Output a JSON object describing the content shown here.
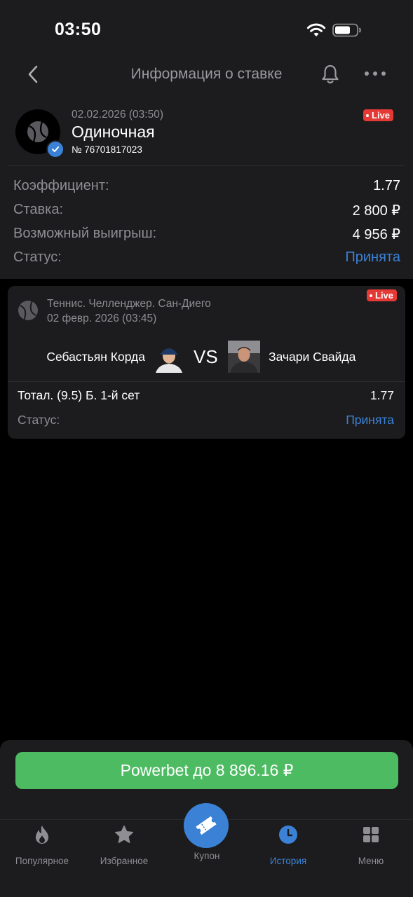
{
  "status_bar": {
    "time": "03:50"
  },
  "nav": {
    "title": "Информация о ставке"
  },
  "bet": {
    "date": "02.02.2026 (03:50)",
    "type": "Одиночная",
    "number": "№ 76701817023",
    "live_label": "Live"
  },
  "details": [
    {
      "key": "Коэффициент:",
      "value": "1.77"
    },
    {
      "key": "Ставка:",
      "value": "2 800 ₽"
    },
    {
      "key": "Возможный выигрыш:",
      "value": "4 956 ₽"
    },
    {
      "key": "Статус:",
      "value": "Принята"
    }
  ],
  "event": {
    "league": "Теннис. Челленджер. Сан-Диего",
    "date": "02 февр. 2026 (03:45)",
    "live_label": "Live",
    "player_left": "Себастьян Корда",
    "player_right": "Зачари Свайда",
    "vs": "VS",
    "market": "Тотал. (9.5) Б. 1-й сет",
    "odds": "1.77",
    "status_key": "Статус:",
    "status_value": "Принята"
  },
  "powerbet": {
    "label": "Powerbet до 8 896.16 ₽"
  },
  "tabs": [
    {
      "label": "Популярное",
      "icon": "fire-icon"
    },
    {
      "label": "Избранное",
      "icon": "star-icon"
    },
    {
      "label": "Купон",
      "icon": "ticket-icon"
    },
    {
      "label": "История",
      "icon": "clock-icon"
    },
    {
      "label": "Меню",
      "icon": "grid-icon"
    }
  ],
  "colors": {
    "accent": "#3b82d6",
    "live": "#e53935",
    "powerbet": "#4cbb62",
    "surface": "#1c1c1e",
    "muted": "#8e8e93"
  }
}
